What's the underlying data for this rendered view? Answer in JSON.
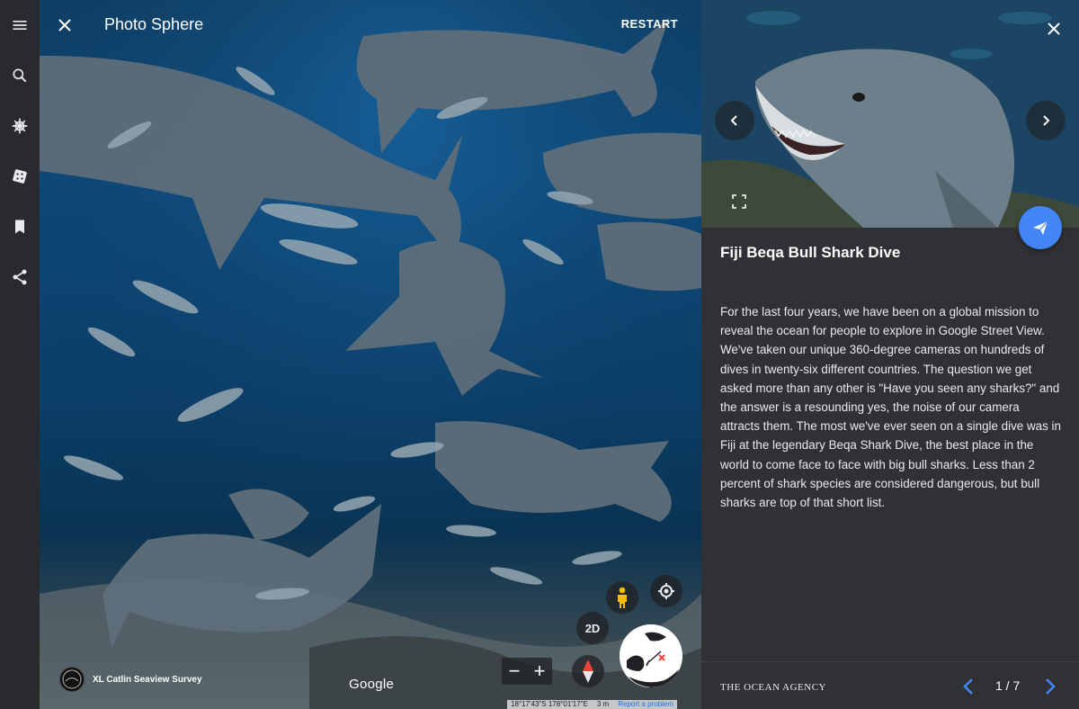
{
  "rail": {
    "items": [
      {
        "icon": "menu-icon"
      },
      {
        "icon": "search-icon"
      },
      {
        "icon": "ship-wheel-icon"
      },
      {
        "icon": "dice-icon"
      },
      {
        "icon": "bookmark-icon"
      },
      {
        "icon": "share-icon"
      }
    ]
  },
  "viewer": {
    "title": "Photo Sphere",
    "restart_label": "RESTART",
    "twod_label": "2D",
    "zoom_out": "−",
    "zoom_in": "+",
    "attribution": "XL Catlin Seaview Survey",
    "google": "Google",
    "coords": "18°17'43\"S 178°01'17\"E",
    "scale": "3 m",
    "report": "Report a problem"
  },
  "panel": {
    "title": "Fiji Beqa Bull Shark Dive",
    "description": "For the last four years, we have been on a global mission to reveal the ocean for people to explore in Google Street View. We've taken our unique 360-degree cameras on hundreds of dives in twenty-six different countries. The question we get asked more than any other is \"Have you seen any sharks?\" and the answer is a resounding yes, the noise of our camera attracts them. The most we've ever seen on a single dive was in Fiji at the legendary Beqa Shark Dive, the best place in the world to come face to face with big bull sharks. Less than 2 percent of shark species are considered dangerous, but bull sharks are top of that short list.",
    "agency": "THE OCEAN AGENCY",
    "page_current": "1",
    "page_total": "7",
    "page_label": "1 / 7"
  },
  "colors": {
    "accent": "#4285f4",
    "panel_bg": "#303134",
    "rail_bg": "#292a2d"
  }
}
